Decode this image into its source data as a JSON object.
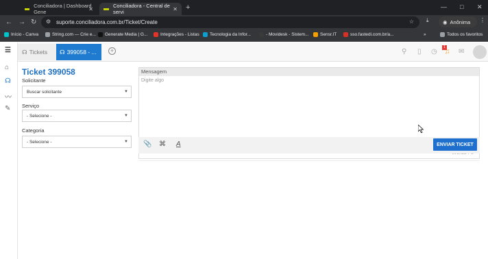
{
  "browser": {
    "tabs": [
      {
        "title": "Conciliadora | Dashboard Gene"
      },
      {
        "title": "Conciliadora - Central de servi"
      }
    ],
    "new_tab": "+",
    "window_controls": [
      "—",
      "□",
      "✕"
    ],
    "url": "suporte.conciliadora.com.br/Ticket/Create",
    "profile": "Anônima",
    "bookmarks": [
      {
        "label": "Início - Canva",
        "color": "#00c4cc"
      },
      {
        "label": "String.com — Crie e...",
        "color": "#9aa0a6"
      },
      {
        "label": "Generate Media | G...",
        "color": "#111111"
      },
      {
        "label": "Integrações - Listas",
        "color": "#e5332a"
      },
      {
        "label": "Tecnologia da Infor...",
        "color": "#0aa0d0"
      },
      {
        "label": "- Movidesk - Sistem...",
        "color": "#3a3a3a"
      },
      {
        "label": "Sensr.IT",
        "color": "#f6a000"
      },
      {
        "label": "sso.fastedi.com.br/a...",
        "color": "#d93025"
      },
      {
        "label": "»",
        "color": ""
      },
      {
        "label": "Todos os favoritos",
        "color": "#9aa0a6"
      }
    ]
  },
  "app": {
    "tabs": {
      "tickets": "Tickets",
      "current": "399058 - ..."
    },
    "ticket_title": "Ticket 399058",
    "fields": {
      "requester_label": "Solicitante",
      "requester_value": "Buscar solicitante",
      "service_label": "Serviço",
      "service_value": "- Selecione -",
      "category_label": "Categoria",
      "category_value": "- Selecione -"
    },
    "message": {
      "header": "Mensagem",
      "placeholder": "Digite algo",
      "words": "Words : 0"
    },
    "send_button": "ENVIAR TICKET",
    "notification_count": "1",
    "accent_color": "#1e7bd0"
  }
}
